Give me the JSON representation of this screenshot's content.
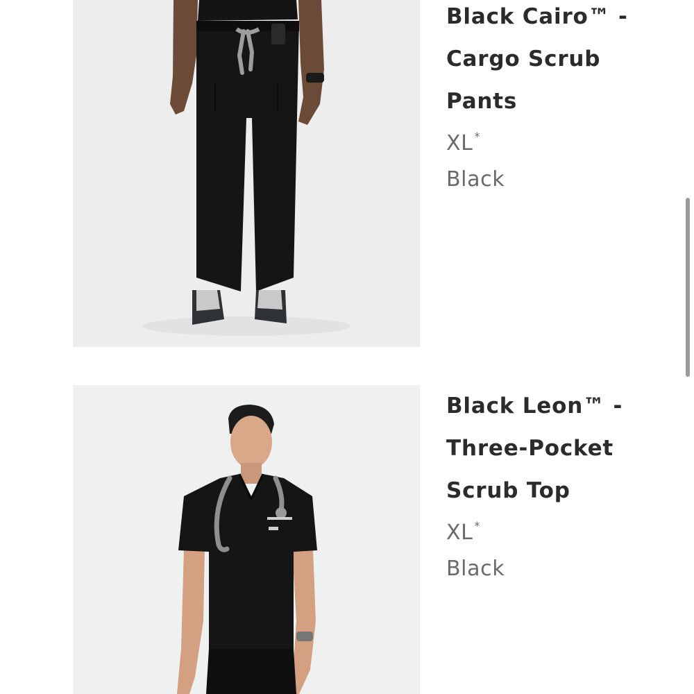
{
  "products": [
    {
      "name": "Black Cairo™ - Cargo Scrub Pants",
      "size": "XL",
      "size_marker": "*",
      "color": "Black",
      "image_icon": "product-photo-pants"
    },
    {
      "name": "Black Leon™ - Three-Pocket Scrub Top",
      "size": "XL",
      "size_marker": "*",
      "color": "Black",
      "image_icon": "product-photo-top"
    }
  ],
  "colors": {
    "background": "#ffffff",
    "title_text": "#2b2b2b",
    "meta_text": "#6a6a6a",
    "scrubs": "#151515",
    "scrollbar": "#9a9a9a"
  }
}
